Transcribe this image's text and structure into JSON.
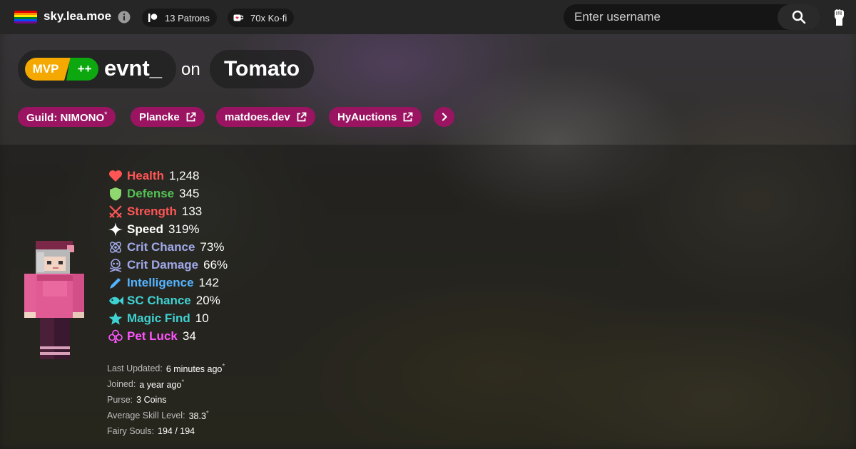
{
  "nav": {
    "site_name": "sky.lea.moe",
    "flag_colors": [
      "#e40303",
      "#ff8c00",
      "#ffed00",
      "#008026",
      "#004dff",
      "#750787"
    ],
    "patrons_label": "13 Patrons",
    "kofi_label": "70x Ko-fi",
    "search_placeholder": "Enter username"
  },
  "header": {
    "rank_main": "MVP",
    "rank_plus": "++",
    "username": "evnt_",
    "on_word": "on",
    "profile_name": "Tomato"
  },
  "links": {
    "guild": "Guild: NIMONO",
    "guild_suffix": "*",
    "plancke": "Plancke",
    "matdoes": "matdoes.dev",
    "hyauctions": "HyAuctions"
  },
  "stats": [
    {
      "name": "Health",
      "value": "1,248",
      "color": "#ff5555",
      "icon": "heart-icon"
    },
    {
      "name": "Defense",
      "value": "345",
      "color": "#55c155",
      "icon": "shield-icon"
    },
    {
      "name": "Strength",
      "value": "133",
      "color": "#ff5555",
      "icon": "crossed-swords-icon"
    },
    {
      "name": "Speed",
      "value": "319%",
      "color": "#ffffff",
      "icon": "sparkle-icon"
    },
    {
      "name": "Crit Chance",
      "value": "73%",
      "color": "#a0a8e8",
      "icon": "atom-icon"
    },
    {
      "name": "Crit Damage",
      "value": "66%",
      "color": "#a0a8e8",
      "icon": "skull-icon"
    },
    {
      "name": "Intelligence",
      "value": "142",
      "color": "#55b4ff",
      "icon": "pencil-icon"
    },
    {
      "name": "SC Chance",
      "value": "20%",
      "color": "#3fd2d2",
      "icon": "fish-icon"
    },
    {
      "name": "Magic Find",
      "value": "10",
      "color": "#3fd2d2",
      "icon": "star-icon"
    },
    {
      "name": "Pet Luck",
      "value": "34",
      "color": "#ff55ff",
      "icon": "club-icon"
    }
  ],
  "meta": {
    "last_updated_label": "Last Updated:",
    "last_updated_value": "6 minutes ago",
    "joined_label": "Joined:",
    "joined_value": "a year ago",
    "purse_label": "Purse:",
    "purse_value": "3 Coins",
    "avg_skill_label": "Average Skill Level:",
    "avg_skill_value": "38.3",
    "fairy_label": "Fairy Souls:",
    "fairy_value": "194 / 194",
    "asterisk": "*"
  }
}
